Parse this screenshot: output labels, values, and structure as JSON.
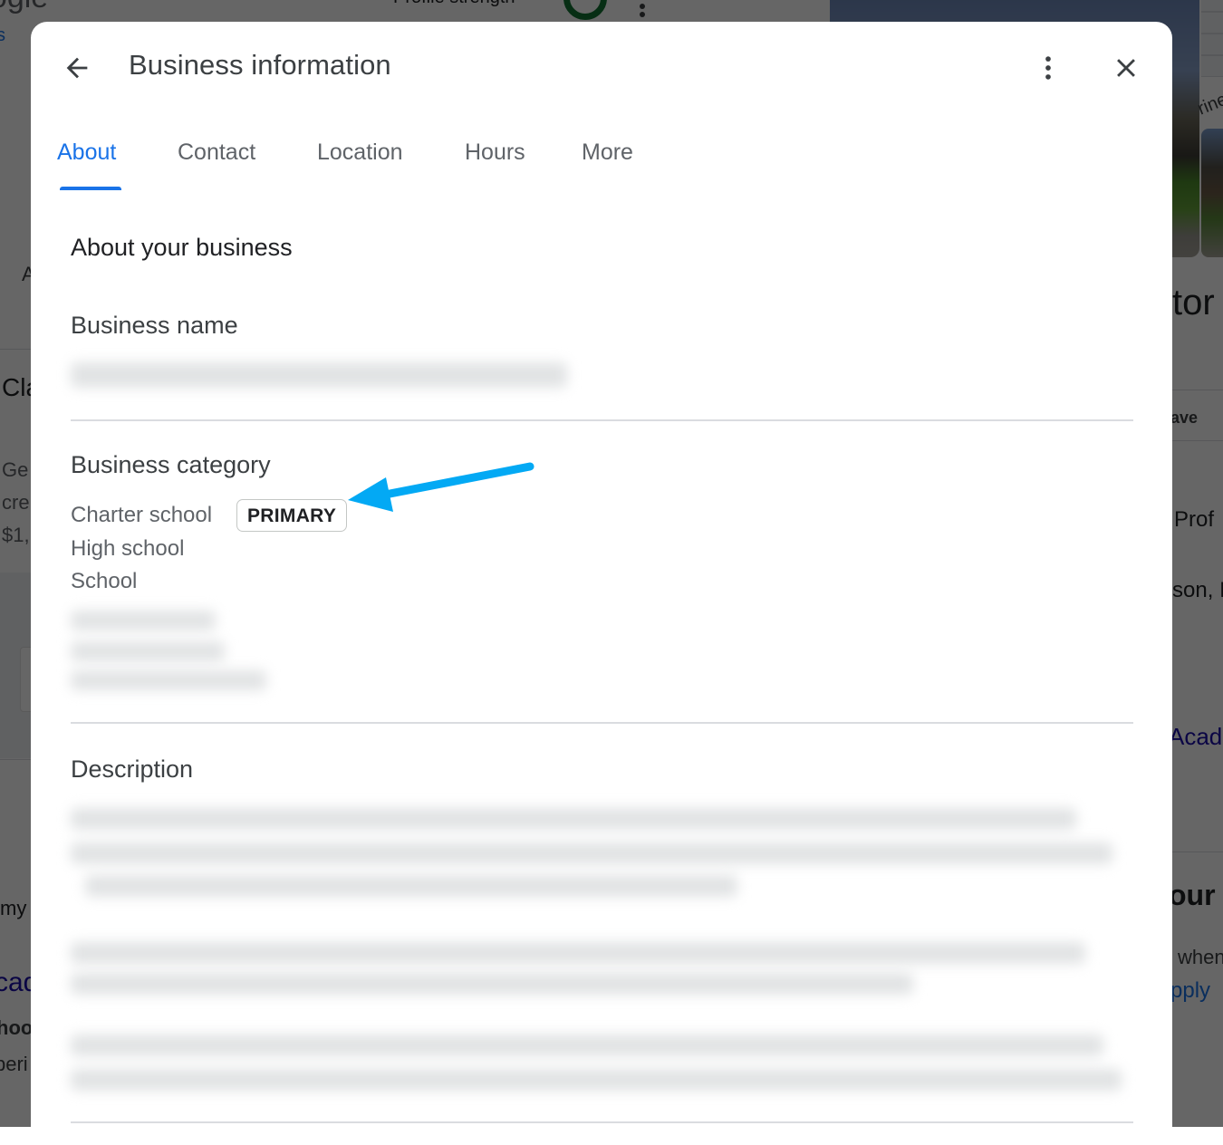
{
  "background": {
    "logo_text": "oogle",
    "link_fragment": "s",
    "profile_strength_label": "Profile strength",
    "left_fragments": [
      "A",
      "Cla",
      "Ge",
      "cre",
      "$1,",
      "my",
      "cad",
      "hoo",
      "peri"
    ],
    "right_fragments": [
      "tor",
      "ave",
      "Prof",
      "son, IN",
      "Acade",
      "our",
      "when",
      "pply"
    ],
    "photo_caption_fragment": "rine"
  },
  "dialog": {
    "title": "Business information",
    "back_label": "Back",
    "more_options_label": "More options",
    "close_label": "Close",
    "tabs": [
      {
        "label": "About",
        "active": true
      },
      {
        "label": "Contact",
        "active": false
      },
      {
        "label": "Location",
        "active": false
      },
      {
        "label": "Hours",
        "active": false
      },
      {
        "label": "More",
        "active": false
      }
    ],
    "section_heading": "About your business",
    "business_name": {
      "label": "Business name",
      "value_redacted": true
    },
    "business_category": {
      "label": "Business category",
      "categories": [
        {
          "name": "Charter school",
          "badge": "PRIMARY"
        },
        {
          "name": "High school"
        },
        {
          "name": "School"
        }
      ],
      "additional_redacted": true
    },
    "description": {
      "label": "Description",
      "value_redacted": true
    }
  },
  "annotation": {
    "type": "arrow",
    "points_to": "PRIMARY badge",
    "color": "#03a9f4"
  },
  "colors": {
    "accent": "#1a73e8",
    "arrow": "#03a9f4",
    "overlay": "rgba(0,0,0,0.6)"
  }
}
